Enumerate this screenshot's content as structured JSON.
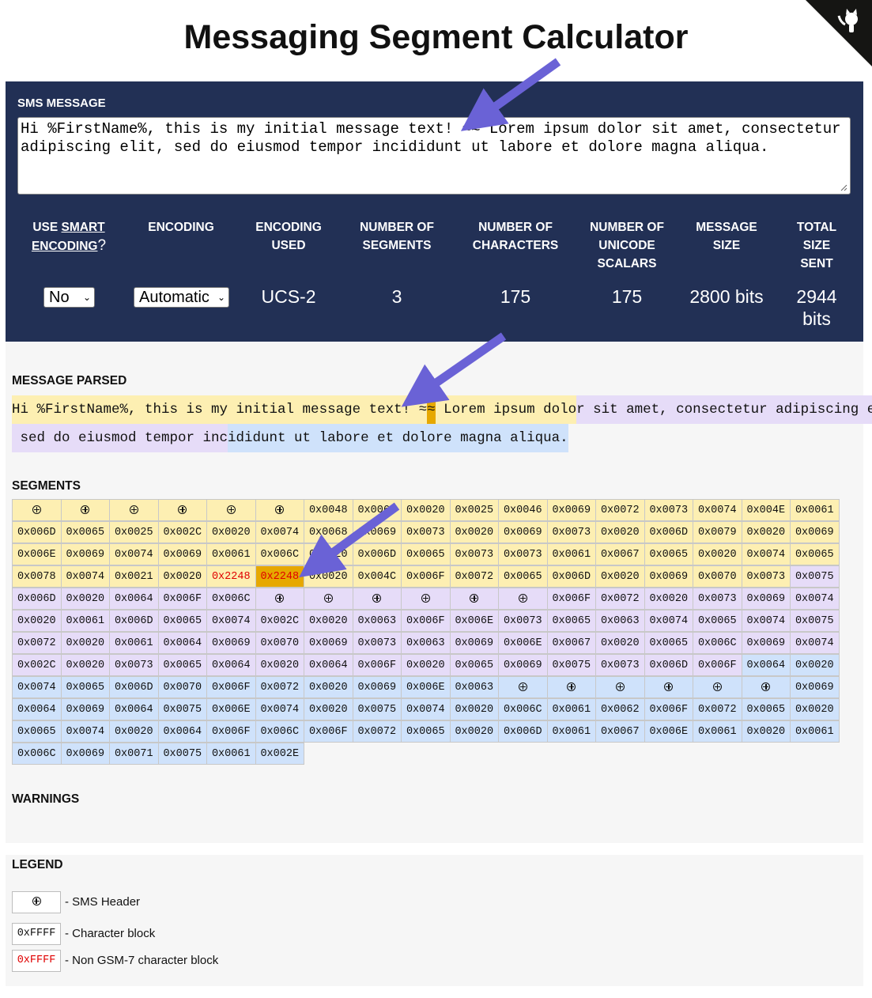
{
  "title": "Messaging Segment Calculator",
  "github_icon": "octocat-icon",
  "sms": {
    "label": "SMS MESSAGE",
    "value": "Hi %FirstName%, this is my initial message text! ≈≈ Lorem ipsum dolor sit amet, consectetur adipiscing elit, sed do eiusmod tempor incididunt ut labore et dolore magna aliqua."
  },
  "columns": {
    "smart_prefix": "USE",
    "smart_link": "SMART",
    "smart_link2": "ENCODING",
    "smart_suffix": "?",
    "encoding": "ENCODING",
    "encoding_used_1": "ENCODING",
    "encoding_used_2": "USED",
    "segments_1": "NUMBER OF",
    "segments_2": "SEGMENTS",
    "characters_1": "NUMBER OF",
    "characters_2": "CHARACTERS",
    "scalars_1": "NUMBER OF",
    "scalars_2": "UNICODE",
    "scalars_3": "SCALARS",
    "size_1": "MESSAGE",
    "size_2": "SIZE",
    "total_1": "TOTAL",
    "total_2": "SIZE SENT"
  },
  "values": {
    "smart": "No",
    "encoding": "Automatic",
    "encoding_used": "UCS-2",
    "segments": "3",
    "characters": "175",
    "scalars": "175",
    "size": "2800 bits",
    "total_1": "2944",
    "total_2": "bits"
  },
  "parsed": {
    "label": "MESSAGE PARSED",
    "line1": [
      {
        "t": "Hi %FirstName%, this is my initial message text! ≈",
        "c": "y"
      },
      {
        "t": "≈",
        "c": "hl"
      },
      {
        "t": " Lorem ipsum dolo",
        "c": "y"
      },
      {
        "t": "r sit amet, consectetur adipiscing elit,",
        "c": "p"
      }
    ],
    "line2": [
      {
        "t": " sed do eiusmod tempor inc",
        "c": "p"
      },
      {
        "t": "ididunt ut labore et dolore magna aliqua.",
        "c": "b"
      }
    ]
  },
  "segments_label": "SEGMENTS",
  "grid": [
    [
      "H",
      "H",
      "H",
      "H",
      "H",
      "H",
      "0x0048",
      "0x0069",
      "0x0020",
      "0x0025",
      "0x0046",
      "0x0069",
      "0x0072",
      "0x0073",
      "0x0074",
      "0x004E",
      "0x0061"
    ],
    [
      "0x006D",
      "0x0065",
      "0x0025",
      "0x002C",
      "0x0020",
      "0x0074",
      "0x0068",
      "0x0069",
      "0x0073",
      "0x0020",
      "0x0069",
      "0x0073",
      "0x0020",
      "0x006D",
      "0x0079",
      "0x0020",
      "0x0069"
    ],
    [
      "0x006E",
      "0x0069",
      "0x0074",
      "0x0069",
      "0x0061",
      "0x006C",
      "0x0020",
      "0x006D",
      "0x0065",
      "0x0073",
      "0x0073",
      "0x0061",
      "0x0067",
      "0x0065",
      "0x0020",
      "0x0074",
      "0x0065"
    ],
    [
      "0x0078",
      "0x0074",
      "0x0021",
      "0x0020",
      "0x2248",
      "0x2248",
      "0x0020",
      "0x004C",
      "0x006F",
      "0x0072",
      "0x0065",
      "0x006D",
      "0x0020",
      "0x0069",
      "0x0070",
      "0x0073",
      "0x0075"
    ],
    [
      "0x006D",
      "0x0020",
      "0x0064",
      "0x006F",
      "0x006C",
      "H",
      "H",
      "H",
      "H",
      "H",
      "H",
      "0x006F",
      "0x0072",
      "0x0020",
      "0x0073",
      "0x0069",
      "0x0074"
    ],
    [
      "0x0020",
      "0x0061",
      "0x006D",
      "0x0065",
      "0x0074",
      "0x002C",
      "0x0020",
      "0x0063",
      "0x006F",
      "0x006E",
      "0x0073",
      "0x0065",
      "0x0063",
      "0x0074",
      "0x0065",
      "0x0074",
      "0x0075"
    ],
    [
      "0x0072",
      "0x0020",
      "0x0061",
      "0x0064",
      "0x0069",
      "0x0070",
      "0x0069",
      "0x0073",
      "0x0063",
      "0x0069",
      "0x006E",
      "0x0067",
      "0x0020",
      "0x0065",
      "0x006C",
      "0x0069",
      "0x0074"
    ],
    [
      "0x002C",
      "0x0020",
      "0x0073",
      "0x0065",
      "0x0064",
      "0x0020",
      "0x0064",
      "0x006F",
      "0x0020",
      "0x0065",
      "0x0069",
      "0x0075",
      "0x0073",
      "0x006D",
      "0x006F",
      "0x0064",
      "0x0020"
    ],
    [
      "0x0074",
      "0x0065",
      "0x006D",
      "0x0070",
      "0x006F",
      "0x0072",
      "0x0020",
      "0x0069",
      "0x006E",
      "0x0063",
      "H",
      "H",
      "H",
      "H",
      "H",
      "H",
      "0x0069"
    ],
    [
      "0x0064",
      "0x0069",
      "0x0064",
      "0x0075",
      "0x006E",
      "0x0074",
      "0x0020",
      "0x0075",
      "0x0074",
      "0x0020",
      "0x006C",
      "0x0061",
      "0x0062",
      "0x006F",
      "0x0072",
      "0x0065",
      "0x0020"
    ],
    [
      "0x0065",
      "0x0074",
      "0x0020",
      "0x0064",
      "0x006F",
      "0x006C",
      "0x006F",
      "0x0072",
      "0x0065",
      "0x0020",
      "0x006D",
      "0x0061",
      "0x0067",
      "0x006E",
      "0x0061",
      "0x0020",
      "0x0061"
    ],
    [
      "0x006C",
      "0x0069",
      "0x0071",
      "0x0075",
      "0x0061",
      "0x002E"
    ]
  ],
  "warnings_label": "WARNINGS",
  "legend": {
    "label": "LEGEND",
    "header_text": "- SMS Header",
    "char_sample": "0xFFFF",
    "char_text": "- Character block",
    "nongsm_sample": "0xFFFF",
    "nongsm_text": "- Non GSM-7 character block"
  },
  "colors": {
    "panel": "#223055",
    "segment1": "#fdefb2",
    "segment2": "#e6dcf8",
    "segment3": "#cfe2fb",
    "highlight": "#e6a800",
    "non_gsm": "#e00000",
    "arrow": "#6a62d6"
  }
}
